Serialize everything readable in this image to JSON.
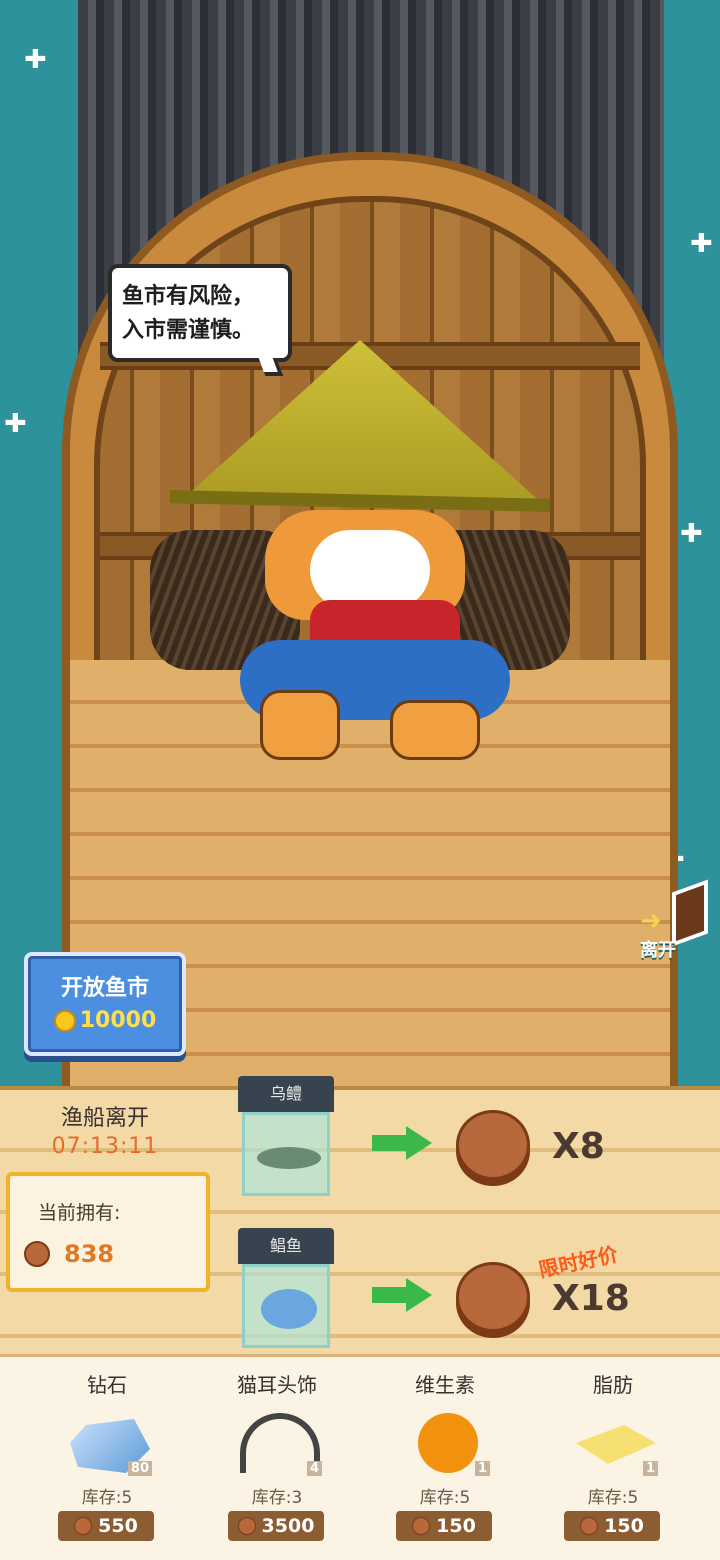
{
  "scene": {
    "speech": [
      "鱼市有风险，",
      "入市需谨慎。"
    ],
    "leave_label": "离开",
    "open_market": {
      "title": "开放鱼市",
      "price": "10000"
    }
  },
  "trade": {
    "boat_leave_title": "渔船离开",
    "countdown": "07:13:11",
    "owned_label": "当前拥有:",
    "owned_value": "838",
    "rows": [
      {
        "fish": "乌鳢",
        "quantity": "X8",
        "promo": ""
      },
      {
        "fish": "鲳鱼",
        "quantity": "X18",
        "promo": "限时好价"
      }
    ]
  },
  "shop": {
    "items": [
      {
        "name": "钻石",
        "icon": "diamond-icon",
        "count": "80",
        "stock": "库存:5",
        "price": "550"
      },
      {
        "name": "猫耳头饰",
        "icon": "cat-ear-headband-icon",
        "count": "4",
        "stock": "库存:3",
        "price": "3500"
      },
      {
        "name": "维生素",
        "icon": "orange-vitamin-icon",
        "count": "1",
        "stock": "库存:5",
        "price": "150"
      },
      {
        "name": "脂肪",
        "icon": "butter-icon",
        "count": "1",
        "stock": "库存:5",
        "price": "150"
      }
    ]
  }
}
